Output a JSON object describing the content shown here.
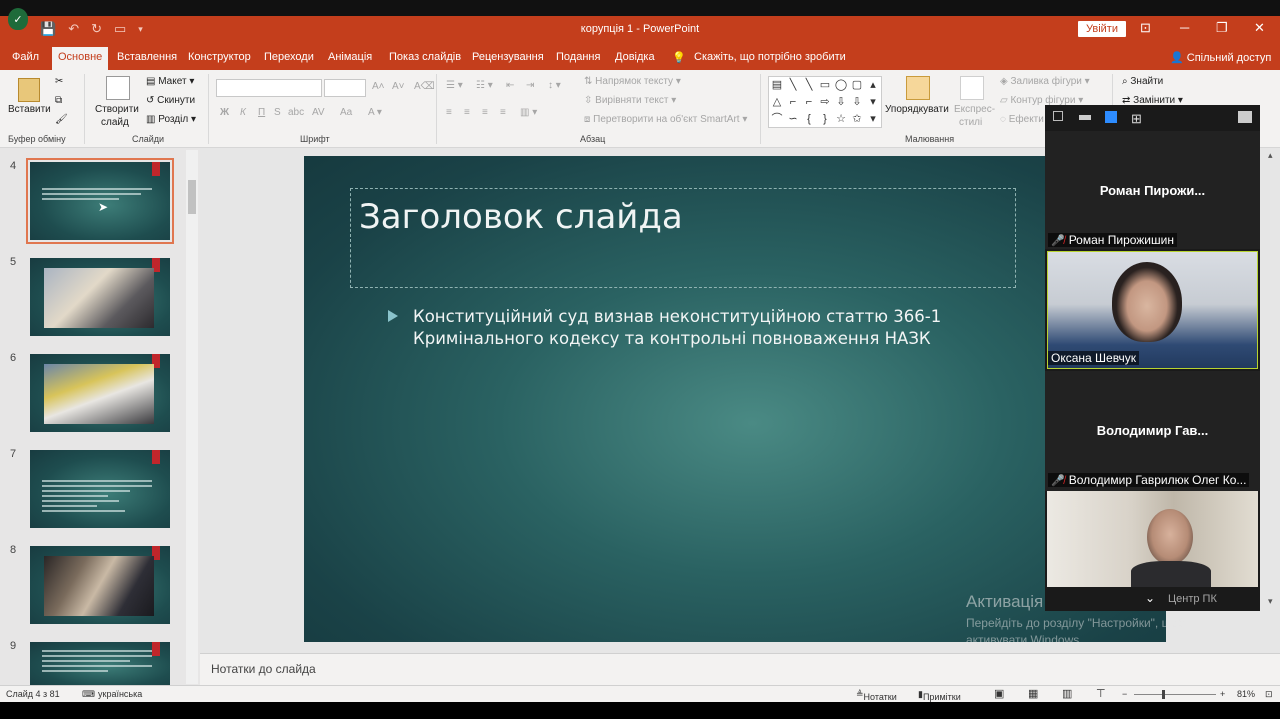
{
  "window": {
    "title": "корупція 1  -  PowerPoint",
    "login_label": "Увійти",
    "minimize": "─",
    "restore": "❐",
    "close": "✕",
    "display_options": "⊡"
  },
  "tabs": [
    {
      "label": "Файл"
    },
    {
      "label": "Основне"
    },
    {
      "label": "Вставлення"
    },
    {
      "label": "Конструктор"
    },
    {
      "label": "Переходи"
    },
    {
      "label": "Анімація"
    },
    {
      "label": "Показ слайдів"
    },
    {
      "label": "Рецензування"
    },
    {
      "label": "Подання"
    },
    {
      "label": "Довідка"
    }
  ],
  "tell_me": "Скажіть, що потрібно зробити",
  "share": "Спільний доступ",
  "ribbon": {
    "paste": "Вставити",
    "clipboard_group": "Буфер обміну",
    "new_slide_1": "Створити",
    "new_slide_2": "слайд",
    "layout": "Макет",
    "reset": "Скинути",
    "section": "Розділ",
    "slides_group": "Слайди",
    "bold": "Ж",
    "italic": "К",
    "underline": "П",
    "strike": "S",
    "shadow": "abc",
    "spacing": "AV",
    "case": "Aa",
    "font_group": "Шрифт",
    "text_direction": "Напрямок тексту",
    "align_text": "Вирівняти текст",
    "smartart": "Перетворити на об'єкт SmartArt",
    "paragraph_group": "Абзац",
    "arrange": "Упорядкувати",
    "quick_styles_1": "Експрес-",
    "quick_styles_2": "стилі",
    "shape_fill": "Заливка фігури",
    "shape_outline": "Контур фігури",
    "shape_effects": "Ефекти",
    "drawing_group": "Малювання",
    "find": "Знайти",
    "replace": "Замінити"
  },
  "thumbnails": [
    {
      "num": "4",
      "selected": true
    },
    {
      "num": "5"
    },
    {
      "num": "6"
    },
    {
      "num": "7"
    },
    {
      "num": "8"
    },
    {
      "num": "9"
    }
  ],
  "slide": {
    "title": "Заголовок слайда",
    "bullet": "Конституційний суд визнав неконституційною статтю 366-1 Кримінального кодексу та контрольні повноваження НАЗК"
  },
  "notes_placeholder": "Нотатки до слайда",
  "status": {
    "slide_count": "Слайд 4 з 81",
    "language": "українська",
    "notes": "Нотатки",
    "comments": "Примітки",
    "zoom": "81%"
  },
  "watermark": {
    "title": "Активація Windows",
    "line1": "Перейдіть до розділу \"Настройки\", щоб",
    "line2": "активувати Windows."
  },
  "zoom_panel": {
    "participants": [
      {
        "display": "Роман  Пирожи...",
        "label": "Роман Пирожишин",
        "muted": true,
        "video": false
      },
      {
        "label": "Оксана Шевчук",
        "muted": false,
        "video": true
      },
      {
        "display": "Володимир  Гав...",
        "label": "Володимир Гаврилюк Олег Ко...",
        "muted": true,
        "video": false
      },
      {
        "label": "Центр ПК",
        "muted": false,
        "video": true
      }
    ]
  }
}
